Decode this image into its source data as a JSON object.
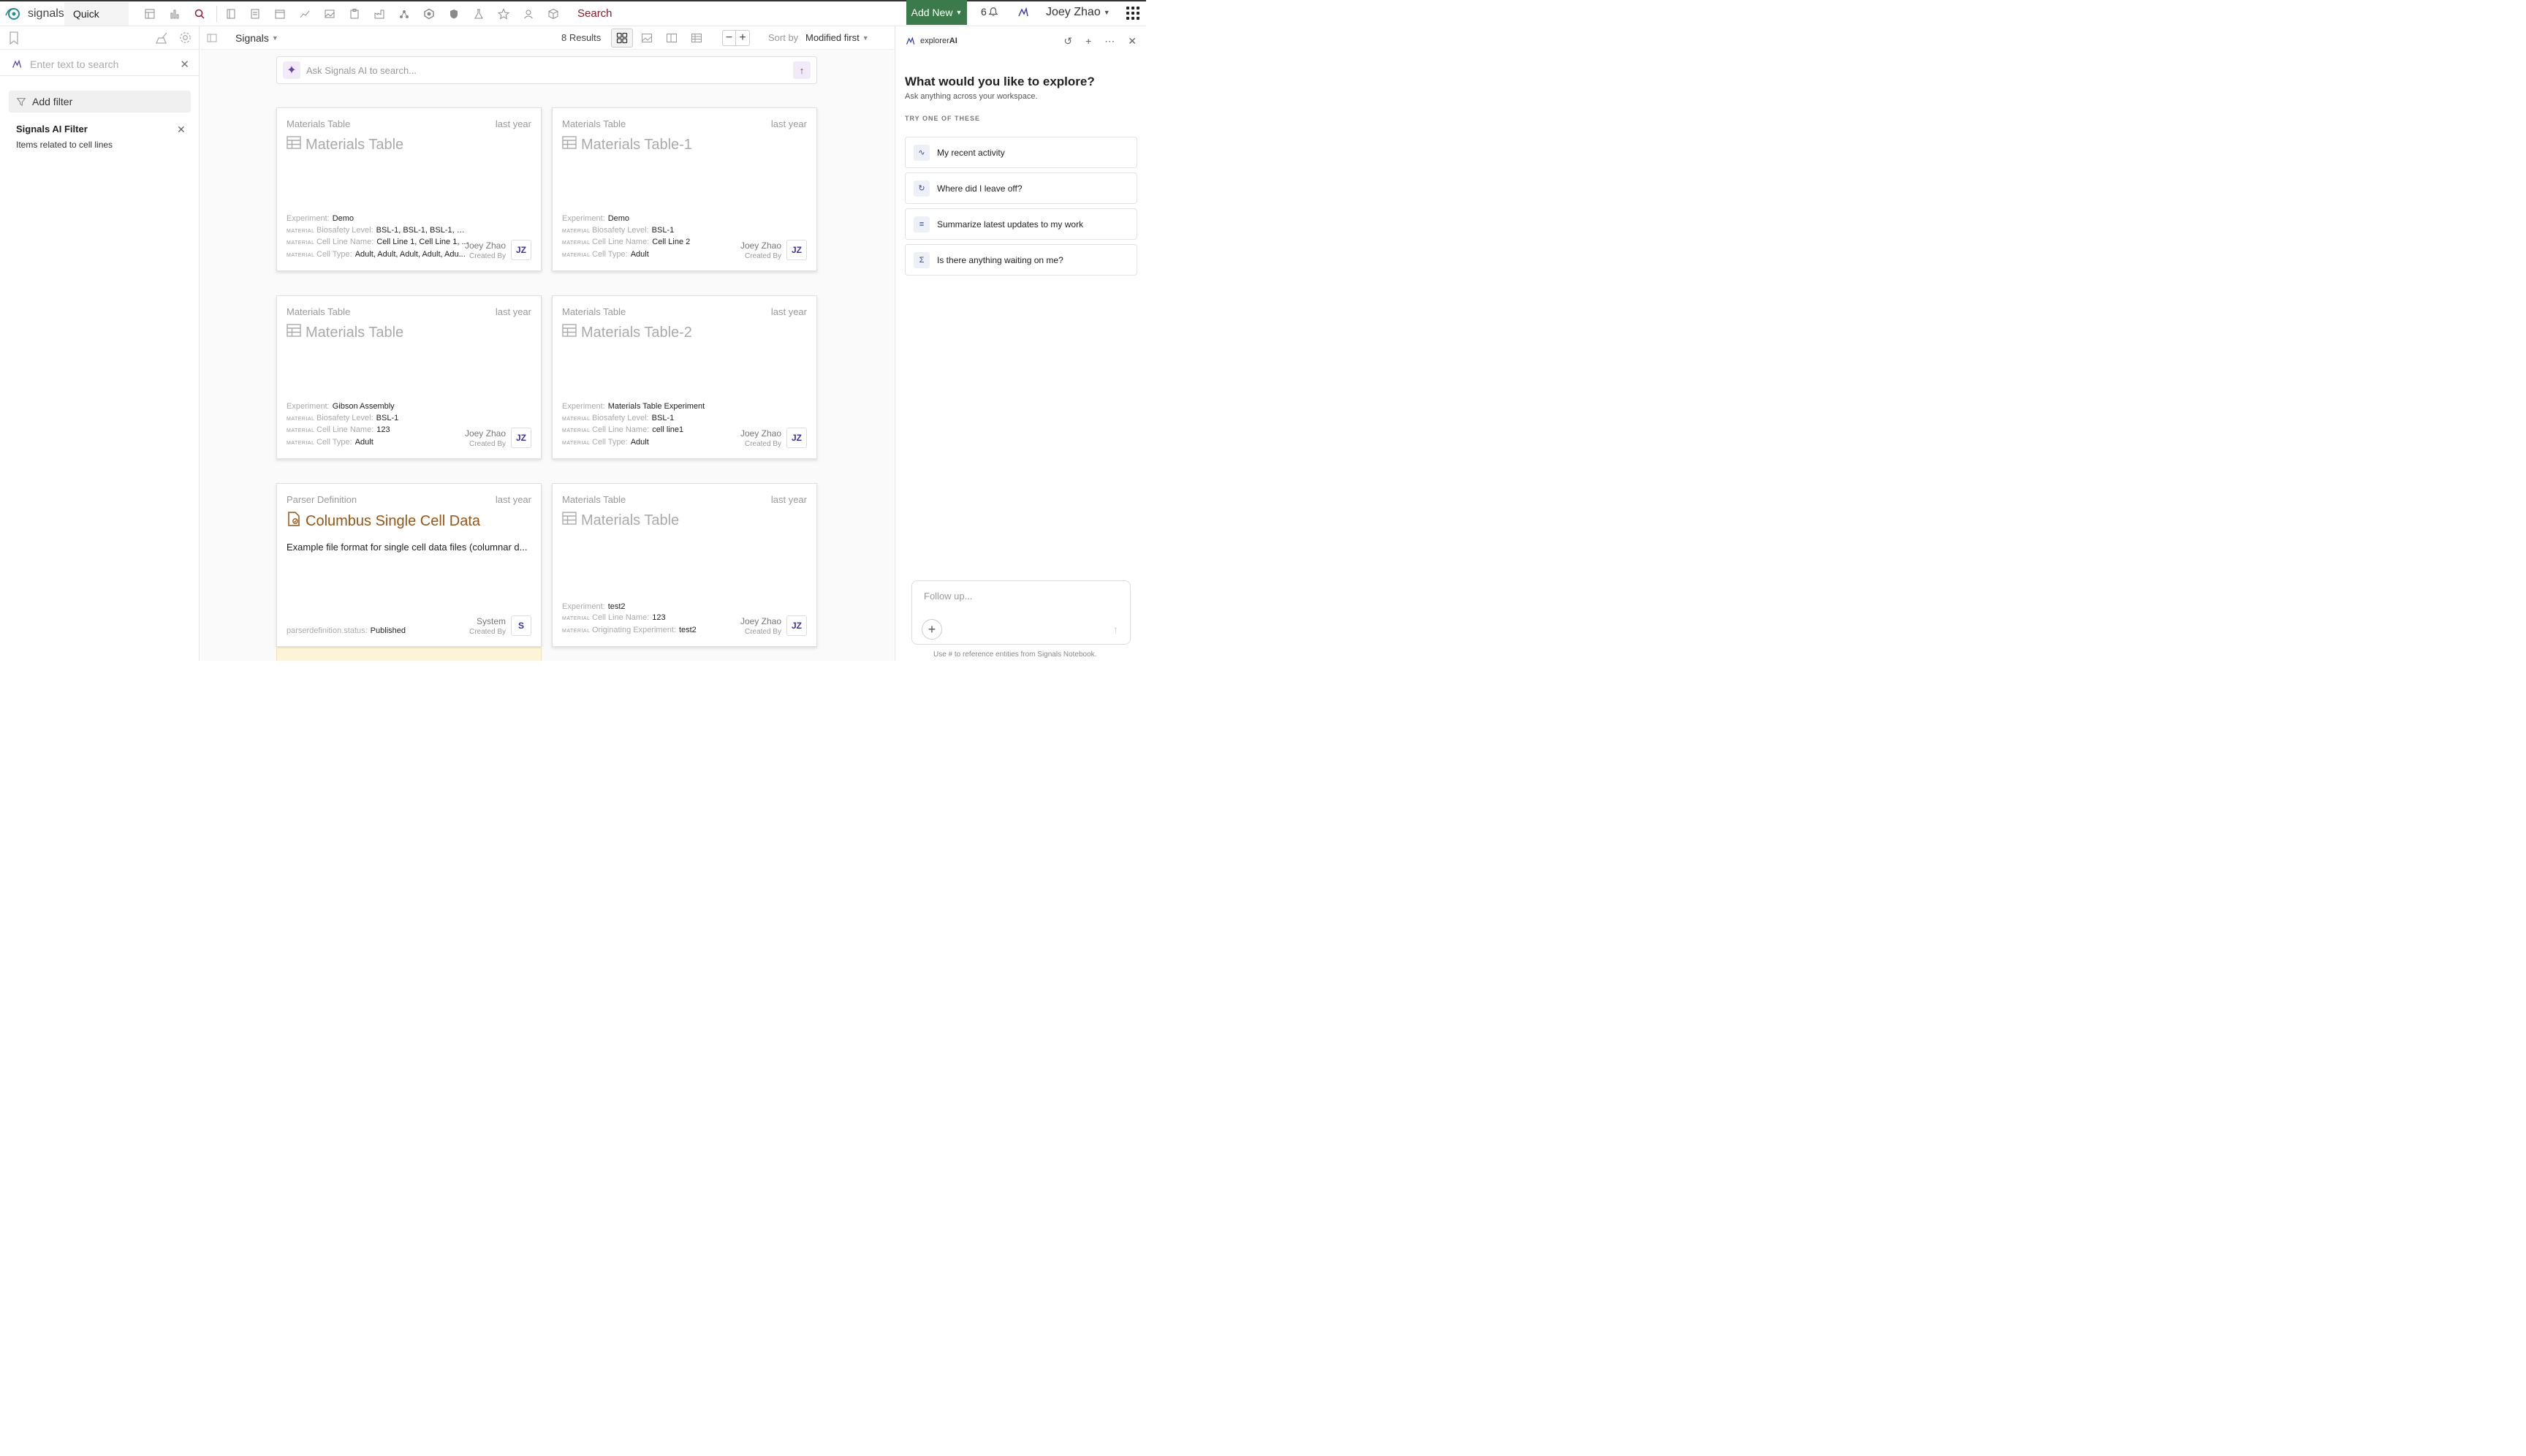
{
  "topbar": {
    "logo_text": "signals",
    "quick_find": "Quick Find",
    "search_label": "Search",
    "add_new": "Add New",
    "notif_count": "6",
    "user_name": "Joey Zhao"
  },
  "leftpanel": {
    "search_placeholder": "Enter text to search",
    "add_filter": "Add filter",
    "ai_filter_title": "Signals AI Filter",
    "ai_filter_desc": "Items related to cell lines"
  },
  "subbar": {
    "scope": "Signals",
    "results": "8 Results",
    "sort_by": "Sort by",
    "sort_value": "Modified first"
  },
  "main": {
    "ai_search_placeholder": "Ask Signals AI to search..."
  },
  "cards": [
    {
      "type": "Materials Table",
      "date": "last year",
      "title": "Materials Table",
      "fields": [
        {
          "prefix": "",
          "label": "Experiment:",
          "value": "Demo"
        },
        {
          "prefix": "MATERIAL",
          "label": "Biosafety Level:",
          "value": "BSL-1, BSL-1, BSL-1, BS..."
        },
        {
          "prefix": "MATERIAL",
          "label": "Cell Line Name:",
          "value": "Cell Line 1, Cell Line 1, ..."
        },
        {
          "prefix": "MATERIAL",
          "label": "Cell Type:",
          "value": "Adult, Adult, Adult, Adult, Adu..."
        }
      ],
      "creator": "Joey Zhao",
      "created_by": "Created By",
      "avatar": "JZ"
    },
    {
      "type": "Materials Table",
      "date": "last year",
      "title": "Materials Table-1",
      "fields": [
        {
          "prefix": "",
          "label": "Experiment:",
          "value": "Demo"
        },
        {
          "prefix": "MATERIAL",
          "label": "Biosafety Level:",
          "value": "BSL-1"
        },
        {
          "prefix": "MATERIAL",
          "label": "Cell Line Name:",
          "value": "Cell Line 2"
        },
        {
          "prefix": "MATERIAL",
          "label": "Cell Type:",
          "value": "Adult"
        }
      ],
      "creator": "Joey Zhao",
      "created_by": "Created By",
      "avatar": "JZ"
    },
    {
      "type": "Materials Table",
      "date": "last year",
      "title": "Materials Table",
      "fields": [
        {
          "prefix": "",
          "label": "Experiment:",
          "value": "Gibson Assembly"
        },
        {
          "prefix": "MATERIAL",
          "label": "Biosafety Level:",
          "value": "BSL-1"
        },
        {
          "prefix": "MATERIAL",
          "label": "Cell Line Name:",
          "value": "123"
        },
        {
          "prefix": "MATERIAL",
          "label": "Cell Type:",
          "value": "Adult"
        }
      ],
      "creator": "Joey Zhao",
      "created_by": "Created By",
      "avatar": "JZ"
    },
    {
      "type": "Materials Table",
      "date": "last year",
      "title": "Materials Table-2",
      "fields": [
        {
          "prefix": "",
          "label": "Experiment:",
          "value": "Materials Table Experiment"
        },
        {
          "prefix": "MATERIAL",
          "label": "Biosafety Level:",
          "value": "BSL-1"
        },
        {
          "prefix": "MATERIAL",
          "label": "Cell Line Name:",
          "value": "cell line1"
        },
        {
          "prefix": "MATERIAL",
          "label": "Cell Type:",
          "value": "Adult"
        }
      ],
      "creator": "Joey Zhao",
      "created_by": "Created By",
      "avatar": "JZ"
    },
    {
      "type": "Parser Definition",
      "date": "last year",
      "title": "Columbus Single Cell Data",
      "description": "Example file format for single cell data files (columnar d...",
      "fields": [
        {
          "prefix": "",
          "label": "parserdefinition.status:",
          "value": "Published"
        }
      ],
      "creator": "System",
      "created_by": "Created By",
      "avatar": "S"
    },
    {
      "type": "Materials Table",
      "date": "last year",
      "title": "Materials Table",
      "fields": [
        {
          "prefix": "",
          "label": "Experiment:",
          "value": "test2"
        },
        {
          "prefix": "MATERIAL",
          "label": "Cell Line Name:",
          "value": "123"
        },
        {
          "prefix": "MATERIAL",
          "label": "Originating Experiment:",
          "value": "test2"
        }
      ],
      "creator": "Joey Zhao",
      "created_by": "Created By",
      "avatar": "JZ"
    }
  ],
  "rightpanel": {
    "logo_prefix": "explorer",
    "logo_suffix": "AI",
    "question": "What would you like to explore?",
    "subtitle": "Ask anything across your workspace.",
    "try_label": "TRY ONE OF THESE",
    "suggestions": [
      {
        "icon": "activity-icon",
        "label": "My recent activity"
      },
      {
        "icon": "history-icon",
        "label": "Where did I leave off?"
      },
      {
        "icon": "summarize-icon",
        "label": "Summarize latest updates to my work"
      },
      {
        "icon": "sigma-icon",
        "label": "Is there anything waiting on me?"
      }
    ],
    "followup_placeholder": "Follow up...",
    "hint": "Use # to reference entities from Signals Notebook."
  },
  "colors": {
    "add_new_bg": "#3b7a4a",
    "search_label": "#8b1a2b",
    "parser_title": "#9a5412",
    "avatar_text": "#3b2fa8"
  }
}
